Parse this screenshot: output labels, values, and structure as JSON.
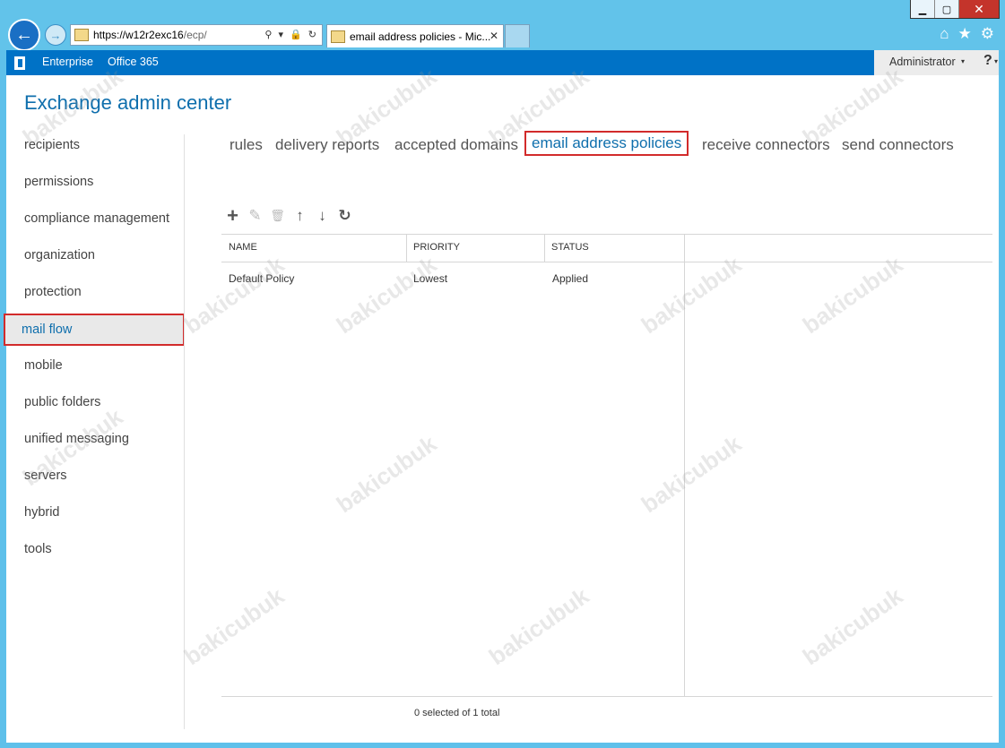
{
  "browser": {
    "url_host": "https://w12r2exc16",
    "url_path": "/ecp/",
    "address_tools": "⚲ ▾ 🔒 ↻",
    "tab_title": "email address policies - Mic...",
    "tab_close": "✕",
    "back_icon": "arrow-left-icon",
    "forward_icon": "arrow-right-icon"
  },
  "window": {
    "minimize": "▁",
    "maximize": "▢",
    "close": "✕"
  },
  "topbar": {
    "link_enterprise": "Enterprise",
    "link_office365": "Office 365",
    "user": "Administrator",
    "help": "?",
    "caret": "▾"
  },
  "app_title": "Exchange admin center",
  "leftnav": {
    "items": [
      {
        "label": "recipients"
      },
      {
        "label": "permissions"
      },
      {
        "label": "compliance management"
      },
      {
        "label": "organization"
      },
      {
        "label": "protection"
      },
      {
        "label": "mail flow"
      },
      {
        "label": "mobile"
      },
      {
        "label": "public folders"
      },
      {
        "label": "unified messaging"
      },
      {
        "label": "servers"
      },
      {
        "label": "hybrid"
      },
      {
        "label": "tools"
      }
    ],
    "active_index": 5
  },
  "subtabs": [
    {
      "label": "rules"
    },
    {
      "label": "delivery reports"
    },
    {
      "label": "accepted domains"
    },
    {
      "label": "email address policies"
    },
    {
      "label": "receive connectors"
    },
    {
      "label": "send connectors"
    }
  ],
  "toolbar": {
    "add": "+",
    "edit": "✎",
    "delete": "🗑",
    "up": "↑",
    "down": "↓",
    "refresh": "↻"
  },
  "grid": {
    "columns": [
      "NAME",
      "PRIORITY",
      "STATUS"
    ],
    "rows": [
      {
        "name": "Default Policy",
        "priority": "Lowest",
        "status": "Applied"
      }
    ]
  },
  "footer": "0 selected of 1 total",
  "watermark_text": "bakicubuk"
}
